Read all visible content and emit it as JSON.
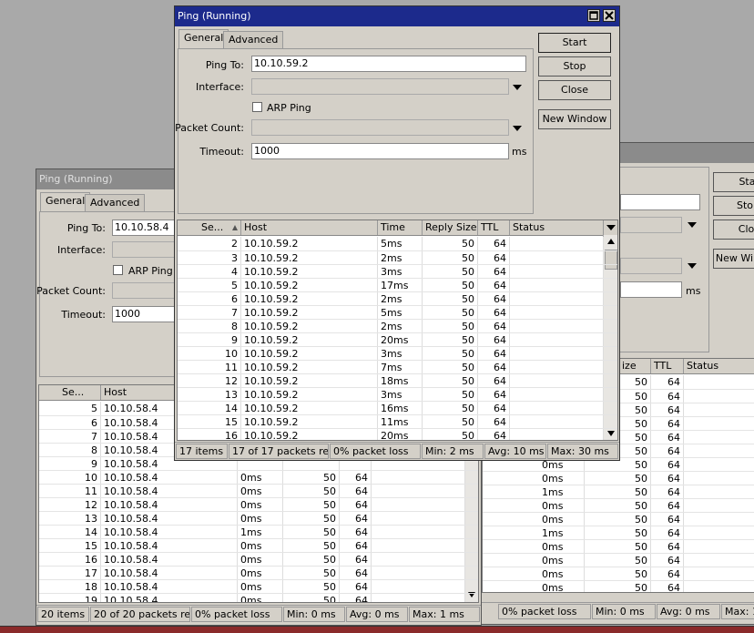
{
  "back_window": {
    "title": "Ping (Running)",
    "tabs": [
      "General",
      "Advanced"
    ],
    "labels": {
      "ping_to": "Ping To:",
      "interface": "Interface:",
      "arp_ping": "ARP Ping",
      "packet_count": "Packet Count:",
      "timeout": "Timeout:"
    },
    "ping_to": "10.10.58.4",
    "timeout": "1000",
    "columns": [
      "Se...",
      "Host"
    ],
    "rows": [
      {
        "seq": "5",
        "host": "10.10.58.4",
        "time": "",
        "size": "",
        "ttl": ""
      },
      {
        "seq": "6",
        "host": "10.10.58.4",
        "time": "",
        "size": "",
        "ttl": ""
      },
      {
        "seq": "7",
        "host": "10.10.58.4",
        "time": "",
        "size": "",
        "ttl": ""
      },
      {
        "seq": "8",
        "host": "10.10.58.4",
        "time": "",
        "size": "",
        "ttl": ""
      },
      {
        "seq": "9",
        "host": "10.10.58.4",
        "time": "",
        "size": "",
        "ttl": ""
      },
      {
        "seq": "10",
        "host": "10.10.58.4",
        "time": "0ms",
        "size": "50",
        "ttl": "64"
      },
      {
        "seq": "11",
        "host": "10.10.58.4",
        "time": "0ms",
        "size": "50",
        "ttl": "64"
      },
      {
        "seq": "12",
        "host": "10.10.58.4",
        "time": "0ms",
        "size": "50",
        "ttl": "64"
      },
      {
        "seq": "13",
        "host": "10.10.58.4",
        "time": "0ms",
        "size": "50",
        "ttl": "64"
      },
      {
        "seq": "14",
        "host": "10.10.58.4",
        "time": "1ms",
        "size": "50",
        "ttl": "64"
      },
      {
        "seq": "15",
        "host": "10.10.58.4",
        "time": "0ms",
        "size": "50",
        "ttl": "64"
      },
      {
        "seq": "16",
        "host": "10.10.58.4",
        "time": "0ms",
        "size": "50",
        "ttl": "64"
      },
      {
        "seq": "17",
        "host": "10.10.58.4",
        "time": "0ms",
        "size": "50",
        "ttl": "64"
      },
      {
        "seq": "18",
        "host": "10.10.58.4",
        "time": "0ms",
        "size": "50",
        "ttl": "64"
      },
      {
        "seq": "19",
        "host": "10.10.58.4",
        "time": "0ms",
        "size": "50",
        "ttl": "64"
      }
    ],
    "status": {
      "items": "20 items",
      "packets": "20 of 20 packets re...",
      "loss": "0% packet loss",
      "min": "Min: 0 ms",
      "avg": "Avg: 0 ms",
      "max": "Max: 1 ms"
    }
  },
  "right_window": {
    "buttons": [
      "Star",
      "Stop",
      "Clos",
      "New Win"
    ],
    "timeout_unit": "ms",
    "columns": [
      "ize",
      "TTL",
      "Status"
    ],
    "rows": [
      {
        "time": "",
        "size": "50",
        "ttl": "64"
      },
      {
        "time": "",
        "size": "50",
        "ttl": "64"
      },
      {
        "time": "",
        "size": "50",
        "ttl": "64"
      },
      {
        "time": "",
        "size": "50",
        "ttl": "64"
      },
      {
        "time": "",
        "size": "50",
        "ttl": "64"
      },
      {
        "time": "",
        "size": "50",
        "ttl": "64"
      },
      {
        "time": "0ms",
        "size": "50",
        "ttl": "64"
      },
      {
        "time": "0ms",
        "size": "50",
        "ttl": "64"
      },
      {
        "time": "1ms",
        "size": "50",
        "ttl": "64"
      },
      {
        "time": "0ms",
        "size": "50",
        "ttl": "64"
      },
      {
        "time": "0ms",
        "size": "50",
        "ttl": "64"
      },
      {
        "time": "1ms",
        "size": "50",
        "ttl": "64"
      },
      {
        "time": "0ms",
        "size": "50",
        "ttl": "64"
      },
      {
        "time": "0ms",
        "size": "50",
        "ttl": "64"
      },
      {
        "time": "0ms",
        "size": "50",
        "ttl": "64"
      },
      {
        "time": "0ms",
        "size": "50",
        "ttl": "64"
      }
    ],
    "status": {
      "loss": "0% packet loss",
      "min": "Min: 0 ms",
      "avg": "Avg: 0 ms",
      "max": "Max: 1"
    }
  },
  "front_window": {
    "title": "Ping (Running)",
    "tabs": [
      "General",
      "Advanced"
    ],
    "labels": {
      "ping_to": "Ping To:",
      "interface": "Interface:",
      "arp_ping": "ARP Ping",
      "packet_count": "Packet Count:",
      "timeout": "Timeout:"
    },
    "ping_to": "10.10.59.2",
    "timeout": "1000",
    "timeout_unit": "ms",
    "buttons": {
      "start": "Start",
      "stop": "Stop",
      "close": "Close",
      "new_window": "New Window"
    },
    "columns": [
      "Se...",
      "Host",
      "Time",
      "Reply Size",
      "TTL",
      "Status"
    ],
    "rows": [
      {
        "seq": "2",
        "host": "10.10.59.2",
        "time": "5ms",
        "size": "50",
        "ttl": "64"
      },
      {
        "seq": "3",
        "host": "10.10.59.2",
        "time": "2ms",
        "size": "50",
        "ttl": "64"
      },
      {
        "seq": "4",
        "host": "10.10.59.2",
        "time": "3ms",
        "size": "50",
        "ttl": "64"
      },
      {
        "seq": "5",
        "host": "10.10.59.2",
        "time": "17ms",
        "size": "50",
        "ttl": "64"
      },
      {
        "seq": "6",
        "host": "10.10.59.2",
        "time": "2ms",
        "size": "50",
        "ttl": "64"
      },
      {
        "seq": "7",
        "host": "10.10.59.2",
        "time": "5ms",
        "size": "50",
        "ttl": "64"
      },
      {
        "seq": "8",
        "host": "10.10.59.2",
        "time": "2ms",
        "size": "50",
        "ttl": "64"
      },
      {
        "seq": "9",
        "host": "10.10.59.2",
        "time": "20ms",
        "size": "50",
        "ttl": "64"
      },
      {
        "seq": "10",
        "host": "10.10.59.2",
        "time": "3ms",
        "size": "50",
        "ttl": "64"
      },
      {
        "seq": "11",
        "host": "10.10.59.2",
        "time": "7ms",
        "size": "50",
        "ttl": "64"
      },
      {
        "seq": "12",
        "host": "10.10.59.2",
        "time": "18ms",
        "size": "50",
        "ttl": "64"
      },
      {
        "seq": "13",
        "host": "10.10.59.2",
        "time": "3ms",
        "size": "50",
        "ttl": "64"
      },
      {
        "seq": "14",
        "host": "10.10.59.2",
        "time": "16ms",
        "size": "50",
        "ttl": "64"
      },
      {
        "seq": "15",
        "host": "10.10.59.2",
        "time": "11ms",
        "size": "50",
        "ttl": "64"
      },
      {
        "seq": "16",
        "host": "10.10.59.2",
        "time": "20ms",
        "size": "50",
        "ttl": "64"
      }
    ],
    "status": {
      "items": "17 items",
      "packets": "17 of 17 packets re...",
      "loss": "0% packet loss",
      "min": "Min: 2 ms",
      "avg": "Avg: 10 ms",
      "max": "Max: 30 ms"
    }
  }
}
